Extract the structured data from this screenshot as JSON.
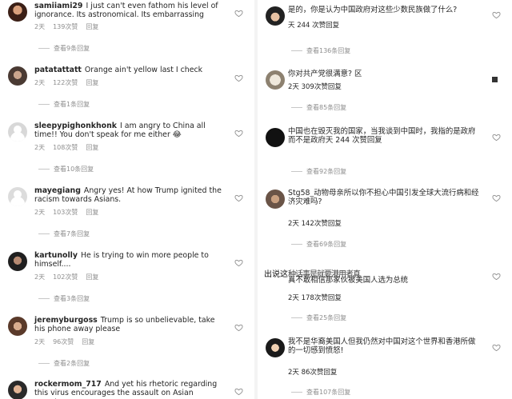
{
  "left": {
    "comments": [
      {
        "username": "samiiami29",
        "text": "I just can't even fathom his level of ignorance. Its astronomical. Its embarrassing",
        "time": "2天",
        "likes": "139次赞",
        "reply": "回复",
        "view_replies": "查看9条回复"
      },
      {
        "username": "patatattatt",
        "text": "Orange ain't yellow last I check",
        "time": "2天",
        "likes": "122次赞",
        "reply": "回复",
        "view_replies": "查看1条回复"
      },
      {
        "username": "sleepypighonkhonk",
        "text": "I am angry to China all time!! You don't speak for me either 😂",
        "time": "2天",
        "likes": "108次赞",
        "reply": "回复",
        "view_replies": "查看10条回复"
      },
      {
        "username": "mayegiang",
        "text": "Angry yes! At how Trump ignited the racism towards Asians.",
        "time": "2天",
        "likes": "103次赞",
        "reply": "回复",
        "view_replies": "查看7条回复"
      },
      {
        "username": "kartunolly",
        "text": "He is trying to win more people to himself....",
        "time": "2天",
        "likes": "102次赞",
        "reply": "回复",
        "view_replies": "查看3条回复"
      },
      {
        "username": "jeremyburgoss",
        "text": "Trump is so unbelievable, take his phone away please",
        "time": "2天",
        "likes": "96次赞",
        "reply": "回复",
        "view_replies": "查看2条回复"
      },
      {
        "username": "rockermom_717",
        "text": "And yet his rhetoric regarding this virus encourages the assault on Asian Americans.",
        "time": "",
        "likes": "",
        "reply": "",
        "view_replies": ""
      }
    ]
  },
  "right": {
    "comments": [
      {
        "text": "是的，你是认为中国政府对这些少数民族做了什么?",
        "meta": "天 244 次赞回复",
        "view_replies": "查看136条回复"
      },
      {
        "text": "你对共产党很满意? 区",
        "meta": "2天 309次赞回复",
        "view_replies": "查看85条回复"
      },
      {
        "text": "中国也在毁灭我的国家，当我谈到中国时，我指的是政府而不是政府天 244 次赞回复",
        "meta": "",
        "view_replies": "查看92条回复"
      },
      {
        "text": "Stg58_动物母亲所以你不担心中国引发全球大流行病和经济灾难吗?",
        "meta": "2天 142次赞回复",
        "view_replies": "查看69条回复"
      },
      {
        "text": "真不敢相信那家伙被美国人选为总统",
        "meta": "2天 178次赞回复",
        "view_replies": "查看25条回复"
      },
      {
        "text": "我不是华裔美国人但我仍然对中国对这个世界和香港所做的一切感到愤怒!",
        "meta": "2天 86次赞回复",
        "view_replies": "查看107条回复"
      }
    ],
    "overlay_caption": "出说这",
    "overlay_ghost": "种话事是就要港用者真"
  },
  "colors": {
    "text": "#262626",
    "muted": "#8e8e8e",
    "divider": "#f4f4f4"
  },
  "icons": {
    "like": "heart-icon",
    "square": "square-icon"
  }
}
